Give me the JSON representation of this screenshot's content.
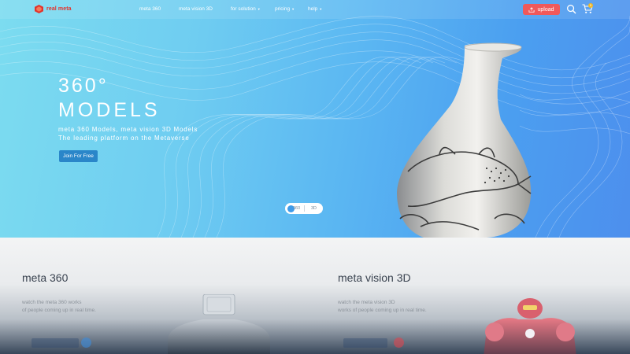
{
  "brand": {
    "name": "real meta",
    "color": "#e2332c"
  },
  "nav": {
    "items": [
      {
        "label": "meta 360",
        "has_dropdown": false
      },
      {
        "label": "meta vision 3D",
        "has_dropdown": false
      },
      {
        "label": "for solution",
        "has_dropdown": true
      },
      {
        "label": "pricing",
        "has_dropdown": true
      },
      {
        "label": "help",
        "has_dropdown": true
      }
    ],
    "upload_label": "upload",
    "upload_color": "#f0595b",
    "search_icon": "search-icon",
    "cart_icon": "cart-icon",
    "cart_count": "0"
  },
  "hero": {
    "title_line1": "360°",
    "title_line2": "MODELS",
    "subtitle_line1": "meta 360 Models, meta vision 3D Models",
    "subtitle_line2": "The leading platform on the Metaverse",
    "cta_label": "Join For Free",
    "toggle": {
      "option_a": "360",
      "option_b": "3D",
      "selected": "360"
    },
    "accent": "#2a86c9"
  },
  "sections": [
    {
      "title": "meta 360",
      "desc_line1": "watch the meta 360 works",
      "desc_line2": "of people coming up in real time."
    },
    {
      "title": "meta vision 3D",
      "desc_line1": "watch the meta vision 3D",
      "desc_line2": "works of people coming up in real time."
    }
  ]
}
